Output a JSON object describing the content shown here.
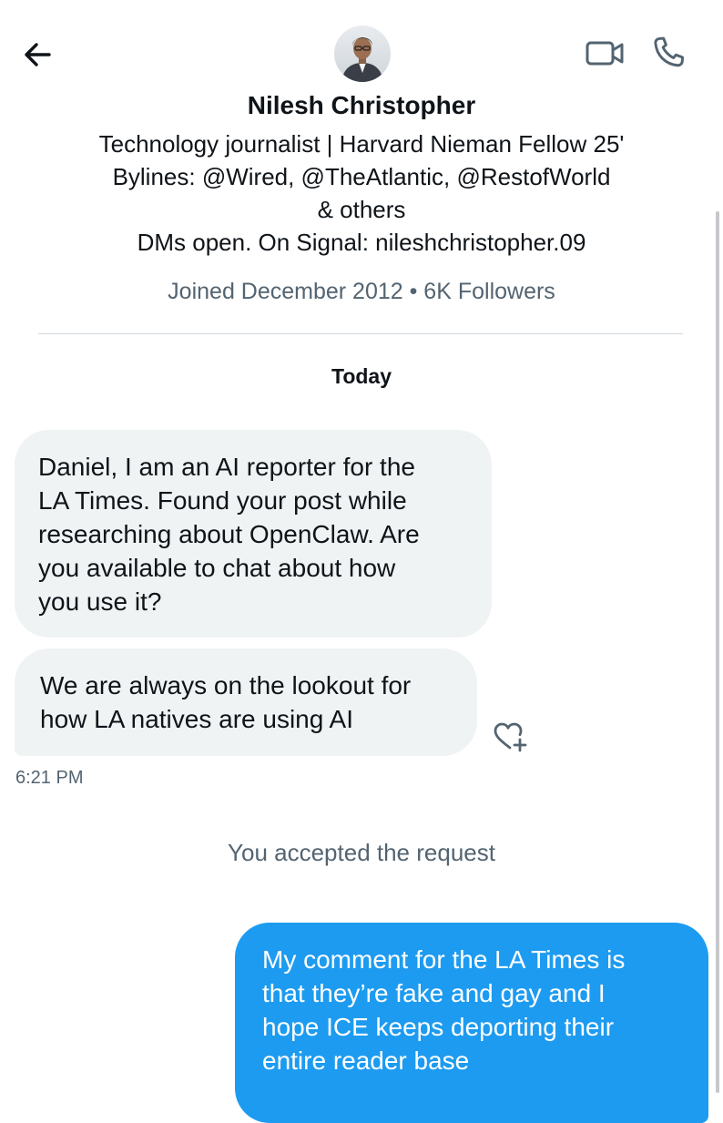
{
  "header": {
    "back_icon": "arrow-left-icon",
    "video_icon": "video-camera-icon",
    "call_icon": "phone-icon",
    "avatar_alt": "Nilesh Christopher"
  },
  "profile": {
    "name": "Nilesh Christopher",
    "bio_lines": [
      "Technology journalist | Harvard Nieman Fellow 25'",
      "Bylines: @Wired, @TheAtlantic, @RestofWorld",
      "& others",
      "DMs open. On Signal: nileshchristopher.09"
    ],
    "meta": "Joined December 2012 • 6K Followers"
  },
  "conversation": {
    "date_separator": "Today",
    "incoming": [
      {
        "lines": [
          "Daniel, I am an AI reporter for the",
          "LA Times. Found your post while",
          "researching about OpenClaw. Are",
          "you available to chat about how",
          "you use it?"
        ]
      },
      {
        "lines": [
          "We are always on the lookout for",
          "how LA natives are using AI"
        ]
      }
    ],
    "react_icon": "heart-plus-icon",
    "timestamp": "6:21 PM",
    "system_message": "You accepted the request",
    "outgoing": [
      {
        "lines": [
          "My comment for the LA Times is",
          "that they’re fake and gay and I",
          "hope ICE keeps deporting their",
          "entire reader base"
        ]
      }
    ]
  },
  "colors": {
    "text": "#0f1419",
    "secondary_text": "#536471",
    "incoming_bubble": "#eff3f4",
    "outgoing_bubble": "#1d9bf0",
    "divider": "#cfd9de"
  }
}
